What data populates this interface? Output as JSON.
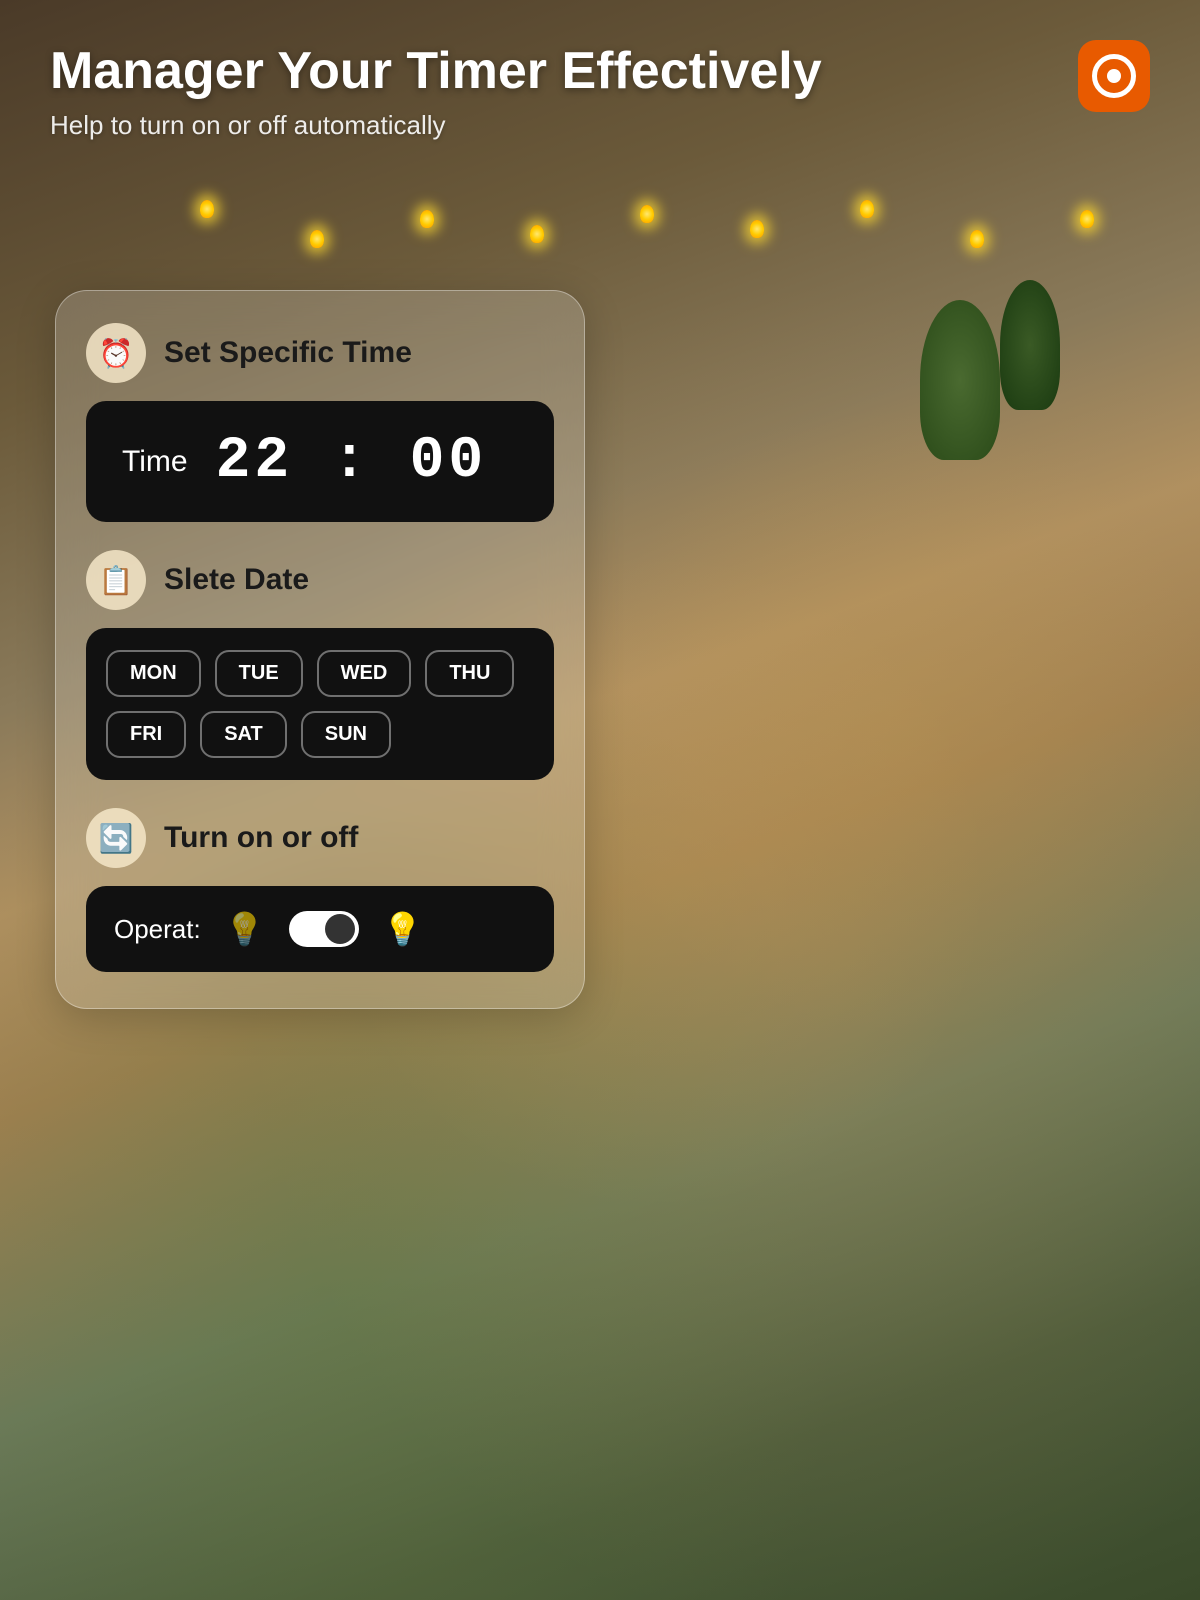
{
  "header": {
    "title": "Manager Your Timer Effectively",
    "subtitle": "Help to turn on or off automatically"
  },
  "brand": {
    "logo_alt": "App Logo"
  },
  "card": {
    "set_time_section": {
      "icon": "⏰",
      "title": "Set Specific Time",
      "time_label": "Time",
      "time_hours": "22",
      "time_separator": ":",
      "time_minutes": "00"
    },
    "select_date_section": {
      "icon": "📋",
      "title": "Slete Date",
      "days": [
        "MON",
        "TUE",
        "WED",
        "THU",
        "FRI",
        "SAT",
        "SUN"
      ]
    },
    "turn_on_off_section": {
      "icon": "🔄",
      "title": "Turn on or off",
      "operate_label": "Operat:",
      "toggle_state": "on"
    }
  }
}
